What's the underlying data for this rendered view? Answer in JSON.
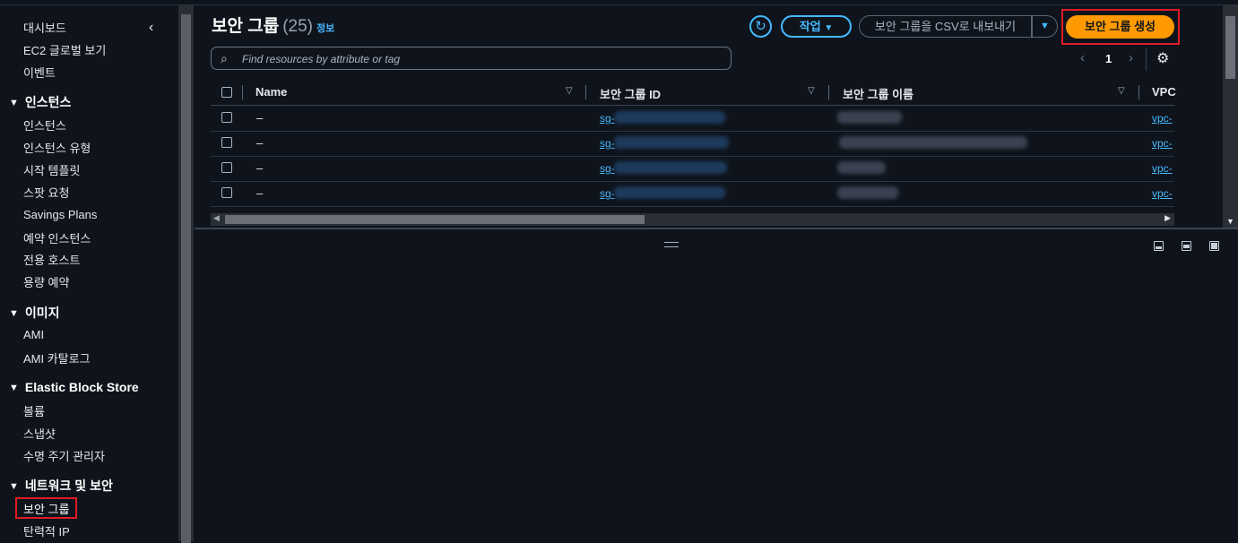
{
  "sidebar": {
    "items": [
      {
        "label": "대시보드"
      },
      {
        "label": "EC2 글로벌 보기"
      },
      {
        "label": "이벤트"
      }
    ],
    "sections": [
      {
        "title": "인스턴스",
        "items": [
          "인스턴스",
          "인스턴스 유형",
          "시작 템플릿",
          "스팟 요청",
          "Savings Plans",
          "예약 인스턴스",
          "전용 호스트",
          "용량 예약"
        ]
      },
      {
        "title": "이미지",
        "items": [
          "AMI",
          "AMI 카탈로그"
        ]
      },
      {
        "title": "Elastic Block Store",
        "items": [
          "볼륨",
          "스냅샷",
          "수명 주기 관리자"
        ]
      },
      {
        "title": "네트워크 및 보안",
        "items": [
          "보안 그룹",
          "탄력적 IP"
        ]
      }
    ],
    "active_item": "보안 그룹"
  },
  "header": {
    "title": "보안 그룹",
    "count": "(25)",
    "info": "정보"
  },
  "toolbar": {
    "actions_label": "작업",
    "export_label": "보안 그룹을 CSV로 내보내기",
    "create_label": "보안 그룹 생성"
  },
  "search": {
    "placeholder": "Find resources by attribute or tag"
  },
  "pagination": {
    "page": "1"
  },
  "table": {
    "columns": [
      "Name",
      "보안 그룹 ID",
      "보안 그룹 이름",
      "VPC"
    ],
    "rows": [
      {
        "name": "–",
        "sg_id": "sg-",
        "vpc": "vpc-"
      },
      {
        "name": "–",
        "sg_id": "sg-",
        "vpc": "vpc-"
      },
      {
        "name": "–",
        "sg_id": "sg-",
        "vpc": "vpc-"
      },
      {
        "name": "–",
        "sg_id": "sg-",
        "vpc": "vpc-"
      }
    ]
  },
  "colors": {
    "accent": "#44b9ff",
    "primary_button": "#ff9900",
    "highlight_box": "#e01b24",
    "background": "#0f141c"
  }
}
